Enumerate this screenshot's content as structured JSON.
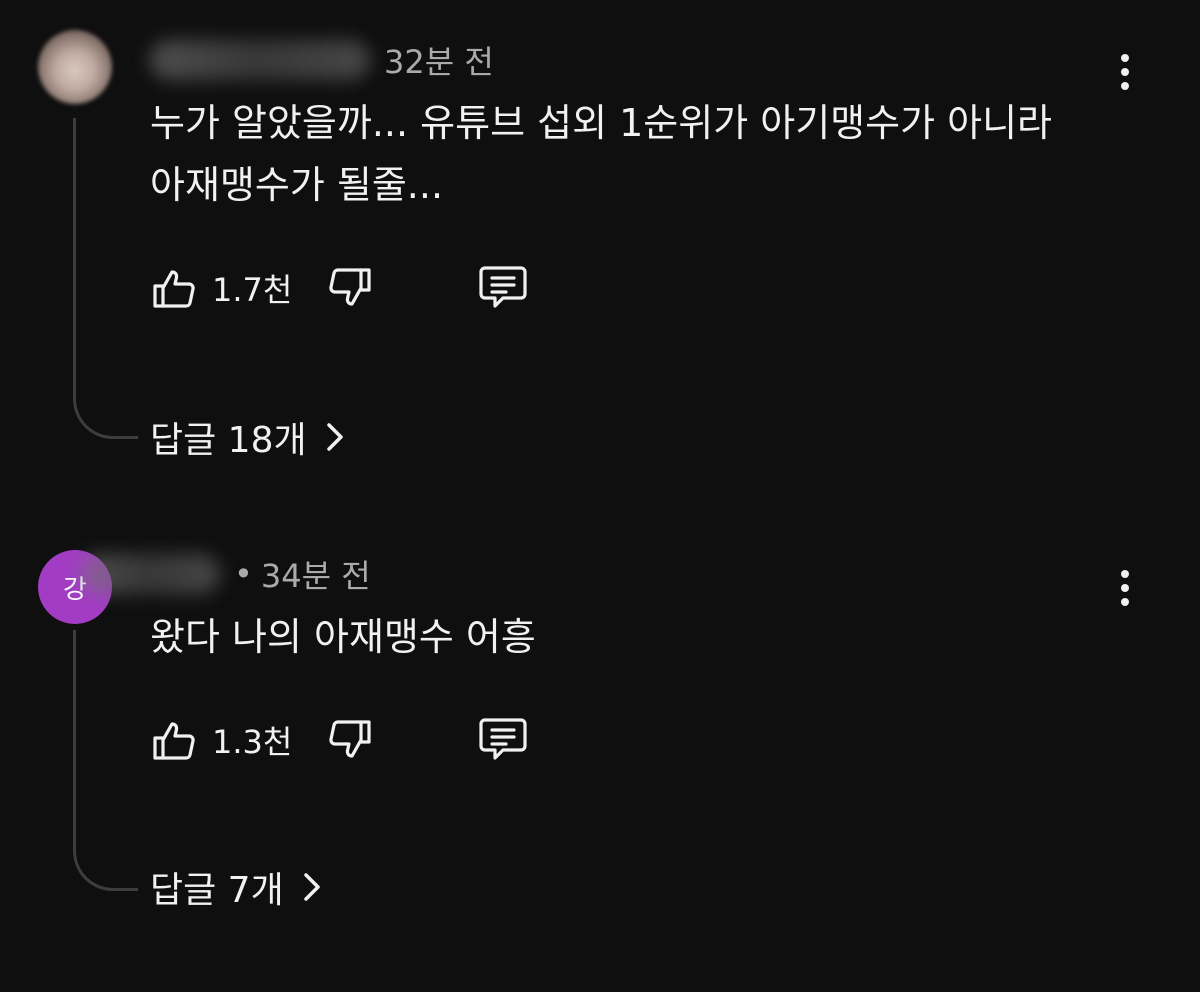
{
  "comments": [
    {
      "author": "",
      "avatar_letter": "",
      "avatar_color": "#d9c8bf",
      "time": "32분 전",
      "text_lines": [
        "누가 알았을까... 유튜브 섭외 1순위가 아기맹수가 아니라",
        "아재맹수가 될줄..."
      ],
      "likes": "1.7천",
      "replies": "답글 18개",
      "icons": {
        "like": "thumbs-up-icon",
        "dislike": "thumbs-down-icon",
        "reply": "comment-icon",
        "more": "more-vert-icon",
        "chevron": "chevron-right-icon"
      }
    },
    {
      "author": "",
      "avatar_letter": "강",
      "avatar_color": "#a23cc4",
      "time": "34분 전",
      "text_lines": [
        "왔다 나의 아재맹수 어흥"
      ],
      "likes": "1.3천",
      "replies": "답글 7개",
      "icons": {
        "like": "thumbs-up-icon",
        "dislike": "thumbs-down-icon",
        "reply": "comment-icon",
        "more": "more-vert-icon",
        "chevron": "chevron-right-icon"
      }
    }
  ]
}
